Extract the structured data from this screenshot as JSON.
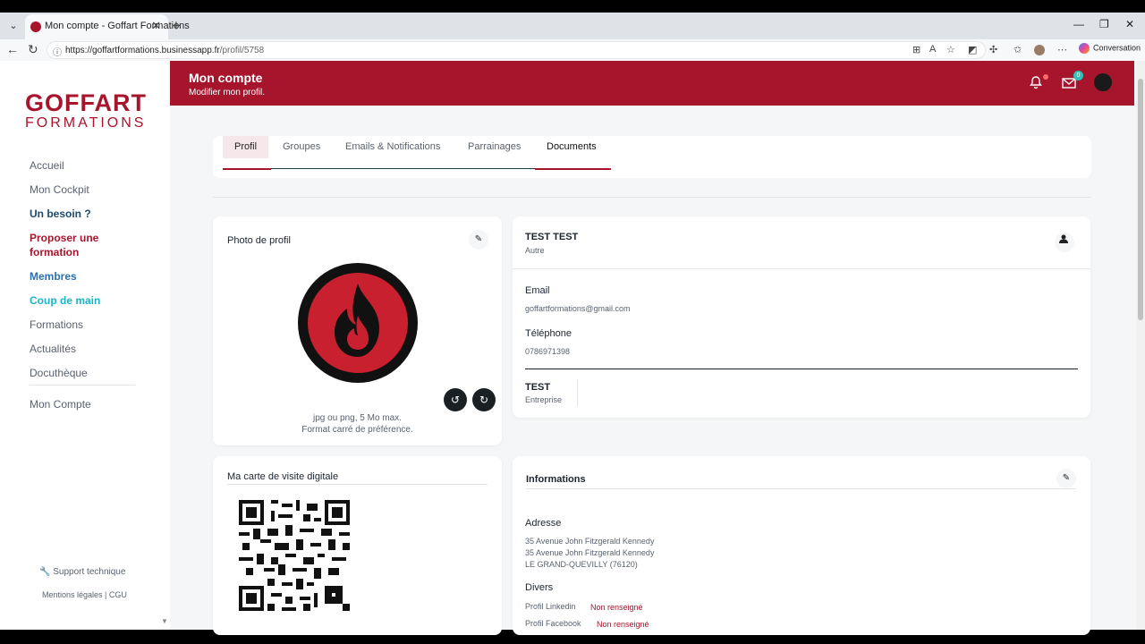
{
  "browser": {
    "tab_title": "Mon compte - Goffart Formations",
    "url_domain": "https://goffartformations.businessapp.fr",
    "url_path": "/profil/5758",
    "conversation_label": "Conversation"
  },
  "brand": {
    "logo_line1": "GOFFART",
    "logo_line2": "FORMATIONS",
    "primary_color": "#a7152d"
  },
  "sidebar": {
    "items": [
      {
        "label": "Accueil"
      },
      {
        "label": "Mon Cockpit"
      },
      {
        "label": "Un besoin ?"
      },
      {
        "label": "Proposer une formation"
      },
      {
        "label": "Membres"
      },
      {
        "label": "Coup de main"
      },
      {
        "label": "Formations"
      },
      {
        "label": "Actualités"
      },
      {
        "label": "Docuthèque"
      }
    ],
    "account": "Mon Compte",
    "support": "Support technique",
    "legal": "Mentions légales",
    "cgu": "CGU"
  },
  "header": {
    "title": "Mon compte",
    "subtitle": "Modifier mon profil.",
    "mail_badge": "0"
  },
  "tabs": [
    {
      "label": "Profil"
    },
    {
      "label": "Groupes"
    },
    {
      "label": "Emails & Notifications"
    },
    {
      "label": "Parrainages"
    },
    {
      "label": "Documents"
    }
  ],
  "photo_card": {
    "title": "Photo de profil",
    "hint1": "jpg ou png, 5 Mo max.",
    "hint2": "Format carré de préférence."
  },
  "vcard": {
    "title": "Ma carte de visite digitale"
  },
  "identity": {
    "name": "TEST TEST",
    "role": "Autre",
    "email_label": "Email",
    "email": "goffartformations@gmail.com",
    "phone_label": "Téléphone",
    "phone": "0786971398",
    "company": "TEST",
    "company_label": "Entreprise"
  },
  "informations": {
    "title": "Informations",
    "address_label": "Adresse",
    "address_line1": "35 Avenue John Fitzgerald Kennedy",
    "address_line2": "35 Avenue John Fitzgerald Kennedy",
    "address_line3": "LE GRAND-QUEVILLY (76120)",
    "divers_label": "Divers",
    "linkedin_label": "Profil Linkedin",
    "linkedin_value": "Non renseigné",
    "facebook_label": "Profil Facebook",
    "facebook_value": "Non renseigné"
  }
}
